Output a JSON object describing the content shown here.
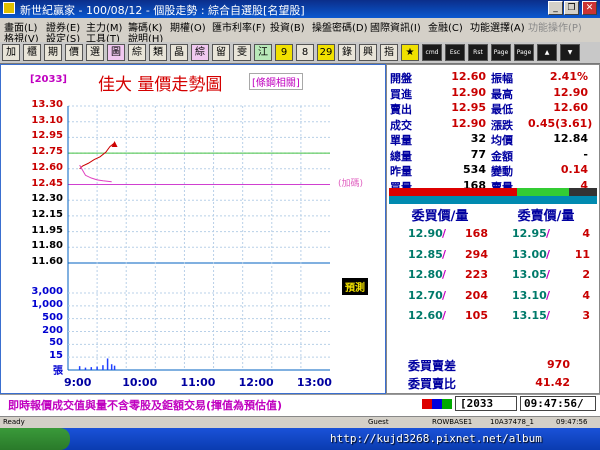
{
  "window": {
    "title": "新世紀贏家 - 100/08/12 - 個股走勢 : 綜合自選股[名望股]",
    "buttons": {
      "minimize": "_",
      "restore": "❐",
      "close": "✕"
    }
  },
  "menu": {
    "row1": [
      {
        "label": "畫面(L)",
        "enabled": true
      },
      {
        "label": "證券(E)",
        "enabled": true
      },
      {
        "label": "主力(M)",
        "enabled": true
      },
      {
        "label": "籌碼(K)",
        "enabled": true
      },
      {
        "label": "期權(O)",
        "enabled": true
      },
      {
        "label": "匯市利率(F)",
        "enabled": true
      },
      {
        "label": "投資(B)",
        "enabled": true
      },
      {
        "label": "操盤密碼(D)",
        "enabled": true
      },
      {
        "label": "國際資訊(I)",
        "enabled": true
      },
      {
        "label": "金融(C)",
        "enabled": true
      },
      {
        "label": "功能選擇(A)",
        "enabled": true
      },
      {
        "label": "功能操作(P)",
        "enabled": false
      }
    ],
    "row2": [
      {
        "label": "格視(V)",
        "enabled": true
      },
      {
        "label": "設定(S)",
        "enabled": true
      },
      {
        "label": "工具(T)",
        "enabled": true
      },
      {
        "label": "說明(H)",
        "enabled": true
      }
    ]
  },
  "toolbar": {
    "buttons": [
      {
        "label": "加",
        "style": "normal"
      },
      {
        "label": "櫃",
        "style": "normal"
      },
      {
        "label": "期",
        "style": "normal"
      },
      {
        "label": "價",
        "style": "normal"
      },
      {
        "label": "選",
        "style": "normal"
      },
      {
        "label": "圖",
        "style": "pink"
      },
      {
        "label": "綜",
        "style": "normal"
      },
      {
        "label": "類",
        "style": "normal"
      },
      {
        "label": "晶",
        "style": "normal"
      },
      {
        "label": "綜",
        "style": "pink"
      },
      {
        "label": "留",
        "style": "normal"
      },
      {
        "label": "雯",
        "style": "normal"
      },
      {
        "label": "江",
        "style": "grn"
      },
      {
        "label": "9",
        "style": "yellow"
      },
      {
        "label": "8",
        "style": "normal"
      },
      {
        "label": "29",
        "style": "yellow"
      },
      {
        "label": "錄",
        "style": "normal"
      },
      {
        "label": "興",
        "style": "normal"
      },
      {
        "label": "指",
        "style": "normal"
      },
      {
        "label": "★",
        "style": "yellow"
      },
      {
        "label": "cmd",
        "style": "dark"
      },
      {
        "label": "Esc",
        "style": "dark"
      },
      {
        "label": "Rst",
        "style": "dark"
      },
      {
        "label": "Page Up",
        "style": "dark"
      },
      {
        "label": "Page Dn",
        "style": "dark"
      },
      {
        "label": "▲",
        "style": "dark"
      },
      {
        "label": "▼",
        "style": "dark"
      }
    ]
  },
  "chart_header": {
    "code": "[2033]",
    "title": "佳大  量價走勢圖",
    "related": "[條鋼相關]"
  },
  "annotations": {
    "markup_note": "(加碼)",
    "forecast": "預測"
  },
  "chart_data": {
    "type": "line",
    "price_axis_labels": [
      "13.30",
      "13.10",
      "12.95",
      "12.75",
      "12.60",
      "12.45",
      "12.30",
      "12.15",
      "11.95",
      "11.80",
      "11.60"
    ],
    "price_ylim": [
      11.6,
      13.3
    ],
    "reference_price": "11.60",
    "volume_axis_labels": [
      "3,000",
      "1,000",
      "500",
      "200",
      "50",
      "15"
    ],
    "volume_unit_label": "張",
    "time_labels": [
      "9:00",
      "10:00",
      "11:00",
      "12:00",
      "13:00"
    ],
    "series": [
      {
        "name": "成交價",
        "color": "#cc0000",
        "x": [
          9.2,
          9.25,
          9.35,
          9.45,
          9.55,
          9.65,
          9.72,
          9.8
        ],
        "y": [
          12.62,
          12.65,
          12.68,
          12.72,
          12.75,
          12.8,
          12.86,
          12.9
        ]
      },
      {
        "name": "均價",
        "color": "#e040c0",
        "x": [
          9.2,
          9.3,
          9.4,
          9.5,
          9.6,
          9.75
        ],
        "y": [
          12.66,
          12.55,
          12.52,
          12.5,
          12.49,
          12.48
        ]
      }
    ],
    "volume_bars": [
      {
        "x": 9.2,
        "v": 40
      },
      {
        "x": 9.3,
        "v": 25
      },
      {
        "x": 9.4,
        "v": 30
      },
      {
        "x": 9.5,
        "v": 35
      },
      {
        "x": 9.6,
        "v": 50
      },
      {
        "x": 9.68,
        "v": 120
      },
      {
        "x": 9.75,
        "v": 60
      },
      {
        "x": 9.8,
        "v": 45
      }
    ]
  },
  "quote": {
    "rows": [
      {
        "l1": "開盤",
        "v1": "12.60",
        "c1": "red",
        "l2": "振幅",
        "v2": "2.41%",
        "c2": "red"
      },
      {
        "l1": "買進",
        "v1": "12.90",
        "c1": "red",
        "l2": "最高",
        "v2": "12.90",
        "c2": "red"
      },
      {
        "l1": "賣出",
        "v1": "12.95",
        "c1": "red",
        "l2": "最低",
        "v2": "12.60",
        "c2": "red"
      },
      {
        "l1": "成交",
        "v1": "12.90",
        "c1": "red",
        "l2": "漲跌",
        "v2": "0.45(3.61)",
        "c2": "red"
      },
      {
        "l1": "單量",
        "v1": "32",
        "c1": "blk",
        "l2": "均價",
        "v2": "12.84",
        "c2": "blk"
      },
      {
        "l1": "總量",
        "v1": "77",
        "c1": "blk",
        "l2": "金額",
        "v2": "-",
        "c2": "blk"
      },
      {
        "l1": "昨量",
        "v1": "534",
        "c1": "blk",
        "l2": "變動",
        "v2": "0.14",
        "c2": "red"
      },
      {
        "l1": "買量",
        "v1": "168",
        "c1": "blk",
        "l2": "賣量",
        "v2": "4",
        "c2": "red"
      }
    ]
  },
  "order_book": {
    "bid_header": "委買價/量",
    "ask_header": "委賣價/量",
    "rows": [
      {
        "bid_price": "12.90",
        "bid_vol": "168",
        "ask_price": "12.95",
        "ask_vol": "4"
      },
      {
        "bid_price": "12.85",
        "bid_vol": "294",
        "ask_price": "13.00",
        "ask_vol": "11"
      },
      {
        "bid_price": "12.80",
        "bid_vol": "223",
        "ask_price": "13.05",
        "ask_vol": "2"
      },
      {
        "bid_price": "12.70",
        "bid_vol": "204",
        "ask_price": "13.10",
        "ask_vol": "4"
      },
      {
        "bid_price": "12.60",
        "bid_vol": "105",
        "ask_price": "13.15",
        "ask_vol": "3"
      }
    ],
    "slash": "/"
  },
  "summary": {
    "diff_label": "委買賣差",
    "diff_value": "970",
    "ratio_label": "委買賣比",
    "ratio_value": "41.42"
  },
  "status": {
    "disclaimer": "即時報價成交值與量不含零股及鉅額交易(揮值為預估值)",
    "code_input": "[2033",
    "clock": "09:47:56/"
  },
  "system_status": {
    "ready": "Ready",
    "guest": "Guest",
    "server": "ROWBASE1",
    "build": "10A37478_1",
    "clock": "09:47:56"
  },
  "watermark": "http://kujd3268.pixnet.net/album"
}
